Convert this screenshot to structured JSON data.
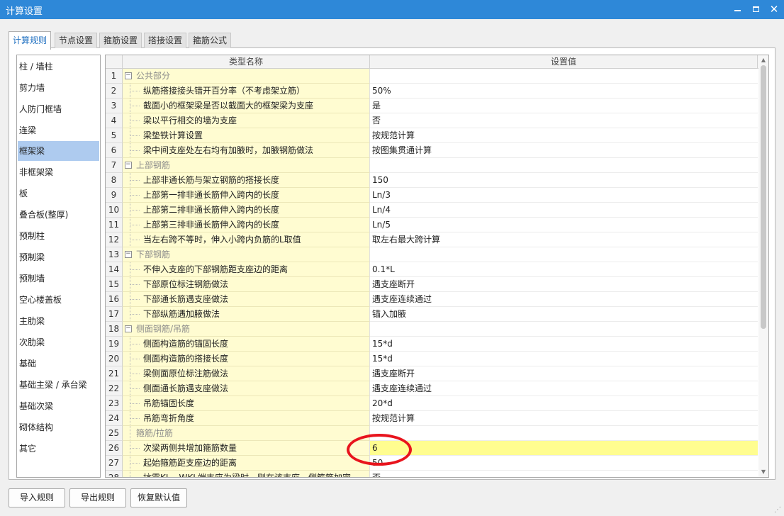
{
  "window": {
    "title": "计算设置",
    "minimize_label": "",
    "close_label": "✕"
  },
  "tabs": [
    {
      "label": "计算规则",
      "active": true
    },
    {
      "label": "节点设置",
      "active": false
    },
    {
      "label": "箍筋设置",
      "active": false
    },
    {
      "label": "搭接设置",
      "active": false
    },
    {
      "label": "箍筋公式",
      "active": false
    }
  ],
  "sidebar": {
    "selected": "框架梁",
    "items": [
      "柱 / 墙柱",
      "剪力墙",
      "人防门框墙",
      "连梁",
      "框架梁",
      "非框架梁",
      "板",
      "叠合板(整厚)",
      "预制柱",
      "预制梁",
      "预制墙",
      "空心楼盖板",
      "主肋梁",
      "次肋梁",
      "基础",
      "基础主梁 / 承台梁",
      "基础次梁",
      "砌体结构",
      "其它"
    ]
  },
  "grid": {
    "columns": {
      "name": "类型名称",
      "value": "设置值"
    },
    "rows": [
      {
        "num": "1",
        "name": "公共部分",
        "value": "",
        "group": true
      },
      {
        "num": "2",
        "name": "纵筋搭接接头错开百分率（不考虑架立筋）",
        "value": "50%"
      },
      {
        "num": "3",
        "name": "截面小的框架梁是否以截面大的框架梁为支座",
        "value": "是"
      },
      {
        "num": "4",
        "name": "梁以平行相交的墙为支座",
        "value": "否"
      },
      {
        "num": "5",
        "name": "梁垫铁计算设置",
        "value": "按规范计算"
      },
      {
        "num": "6",
        "name": "梁中间支座处左右均有加腋时，加腋钢筋做法",
        "value": "按图集贯通计算"
      },
      {
        "num": "7",
        "name": "上部钢筋",
        "value": "",
        "group": true
      },
      {
        "num": "8",
        "name": "上部非通长筋与架立钢筋的搭接长度",
        "value": "150"
      },
      {
        "num": "9",
        "name": "上部第一排非通长筋伸入跨内的长度",
        "value": "Ln/3"
      },
      {
        "num": "10",
        "name": "上部第二排非通长筋伸入跨内的长度",
        "value": "Ln/4"
      },
      {
        "num": "11",
        "name": "上部第三排非通长筋伸入跨内的长度",
        "value": "Ln/5"
      },
      {
        "num": "12",
        "name": "当左右跨不等时，伸入小跨内负筋的L取值",
        "value": "取左右最大跨计算"
      },
      {
        "num": "13",
        "name": "下部钢筋",
        "value": "",
        "group": true
      },
      {
        "num": "14",
        "name": "不伸入支座的下部钢筋距支座边的距离",
        "value": "0.1*L"
      },
      {
        "num": "15",
        "name": "下部原位标注钢筋做法",
        "value": "遇支座断开"
      },
      {
        "num": "16",
        "name": "下部通长筋遇支座做法",
        "value": "遇支座连续通过"
      },
      {
        "num": "17",
        "name": "下部纵筋遇加腋做法",
        "value": "锚入加腋"
      },
      {
        "num": "18",
        "name": "侧面钢筋/吊筋",
        "value": "",
        "group": true
      },
      {
        "num": "19",
        "name": "侧面构造筋的锚固长度",
        "value": "15*d"
      },
      {
        "num": "20",
        "name": "侧面构造筋的搭接长度",
        "value": "15*d"
      },
      {
        "num": "21",
        "name": "梁侧面原位标注筋做法",
        "value": "遇支座断开"
      },
      {
        "num": "22",
        "name": "侧面通长筋遇支座做法",
        "value": "遇支座连续通过"
      },
      {
        "num": "23",
        "name": "吊筋锚固长度",
        "value": "20*d"
      },
      {
        "num": "24",
        "name": "吊筋弯折角度",
        "value": "按规范计算"
      },
      {
        "num": "25",
        "name": "箍筋/拉筋",
        "value": "",
        "group": true,
        "collapsed_marker": "none"
      },
      {
        "num": "26",
        "name": "次梁两侧共增加箍筋数量",
        "value": "6",
        "highlighted": true
      },
      {
        "num": "27",
        "name": "起始箍筋距支座边的距离",
        "value": "50"
      },
      {
        "num": "28",
        "name": "抗震KL、WKL端支座为梁时，则在该支座一侧箍筋加密",
        "value": "否"
      }
    ]
  },
  "buttons": {
    "import": "导入规则",
    "export": "导出规则",
    "restore": "恢复默认值"
  },
  "annotation": {
    "shape": "ellipse",
    "color": "#e8141d"
  }
}
